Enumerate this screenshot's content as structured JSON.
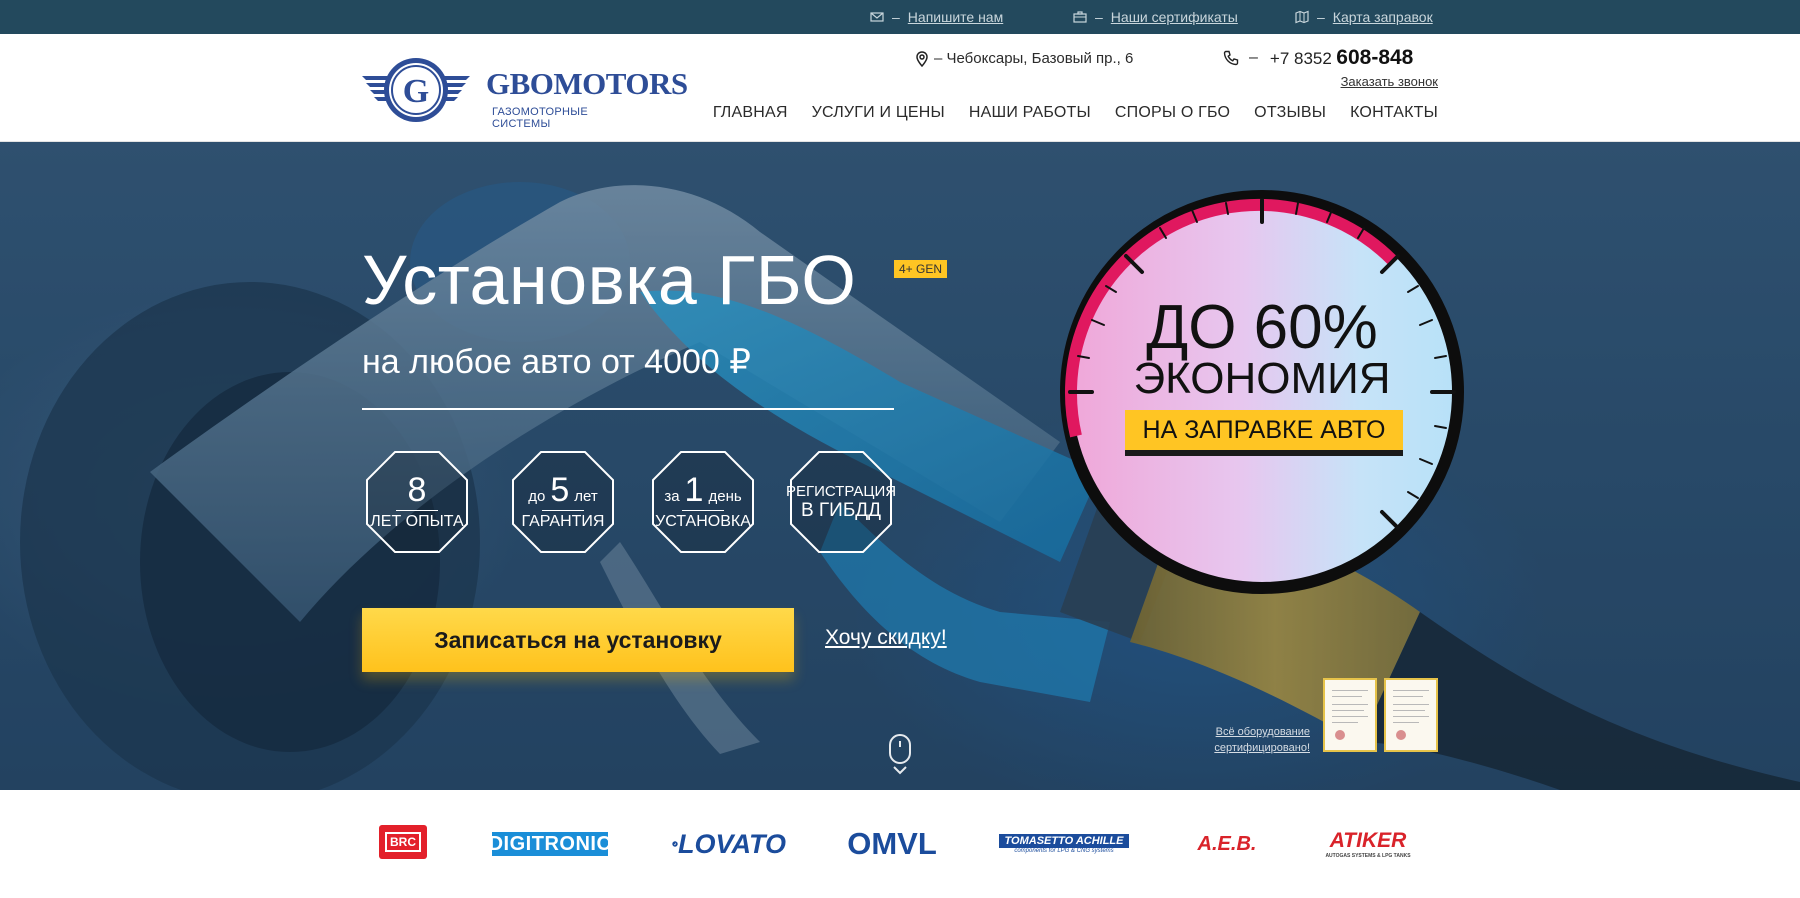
{
  "topbar": {
    "links": [
      {
        "icon": "envelope-icon",
        "label": "Напишите нам"
      },
      {
        "icon": "briefcase-icon",
        "label": "Наши сертификаты"
      },
      {
        "icon": "map-icon",
        "label": "Карта заправок"
      }
    ],
    "separator": "–"
  },
  "header": {
    "logo": {
      "name": "GBOMOTORS",
      "tagline": "ГАЗОМОТОРНЫЕ СИСТЕМЫ",
      "letter": "G"
    },
    "address": "– Чебоксары, Базовый пр., 6",
    "phone_sep": "–",
    "phone_prefix": "+7 8352",
    "phone_main": "608-848",
    "callback": "Заказать звонок",
    "nav": [
      {
        "label": "ГЛАВНАЯ",
        "active": true
      },
      {
        "label": "УСЛУГИ И ЦЕНЫ",
        "active": false
      },
      {
        "label": "НАШИ РАБОТЫ",
        "active": false
      },
      {
        "label": "СПОРЫ О ГБО",
        "active": false
      },
      {
        "label": "ОТЗЫВЫ",
        "active": false
      },
      {
        "label": "КОНТАКТЫ",
        "active": false
      }
    ]
  },
  "hero": {
    "title": "Установка ГБО",
    "badge": "4+ GEN",
    "subtitle": "на любое авто от 4000 ₽",
    "features": [
      {
        "pre": "",
        "big": "8",
        "post": "",
        "bottom": "ЛЕТ ОПЫТА"
      },
      {
        "pre": "до",
        "big": "5",
        "post": "лет",
        "bottom": "ГАРАНТИЯ"
      },
      {
        "pre": "за",
        "big": "1",
        "post": "день",
        "bottom": "УСТАНОВКА"
      },
      {
        "line1": "РЕГИСТРАЦИЯ",
        "line2": "В ГИБДД"
      }
    ],
    "cta": "Записаться на установку",
    "discount": "Хочу скидку!",
    "gauge": {
      "line1": "ДО 60%",
      "line2": "ЭКОНОМИЯ",
      "button": "НА ЗАПРАВКЕ АВТО"
    },
    "cert_note": "Всё оборудование сертифицировано!"
  },
  "brands": {
    "brc": "BRC",
    "digitronic": "DIGITRONIC",
    "lovato": "LOVATO",
    "omvl": "OMVL",
    "tomasetto": "TOMASETTO ACHILLE",
    "tomasetto_sub": "components for LPG & CNG systems",
    "aeb": "A.E.B.",
    "atiker": "ATIKER",
    "atiker_sub": "AUTOGAS SYSTEMS & LPG TANKS"
  },
  "colors": {
    "accent": "#ffc523",
    "topbar": "#23495d",
    "brand_blue": "#2e4d97"
  }
}
